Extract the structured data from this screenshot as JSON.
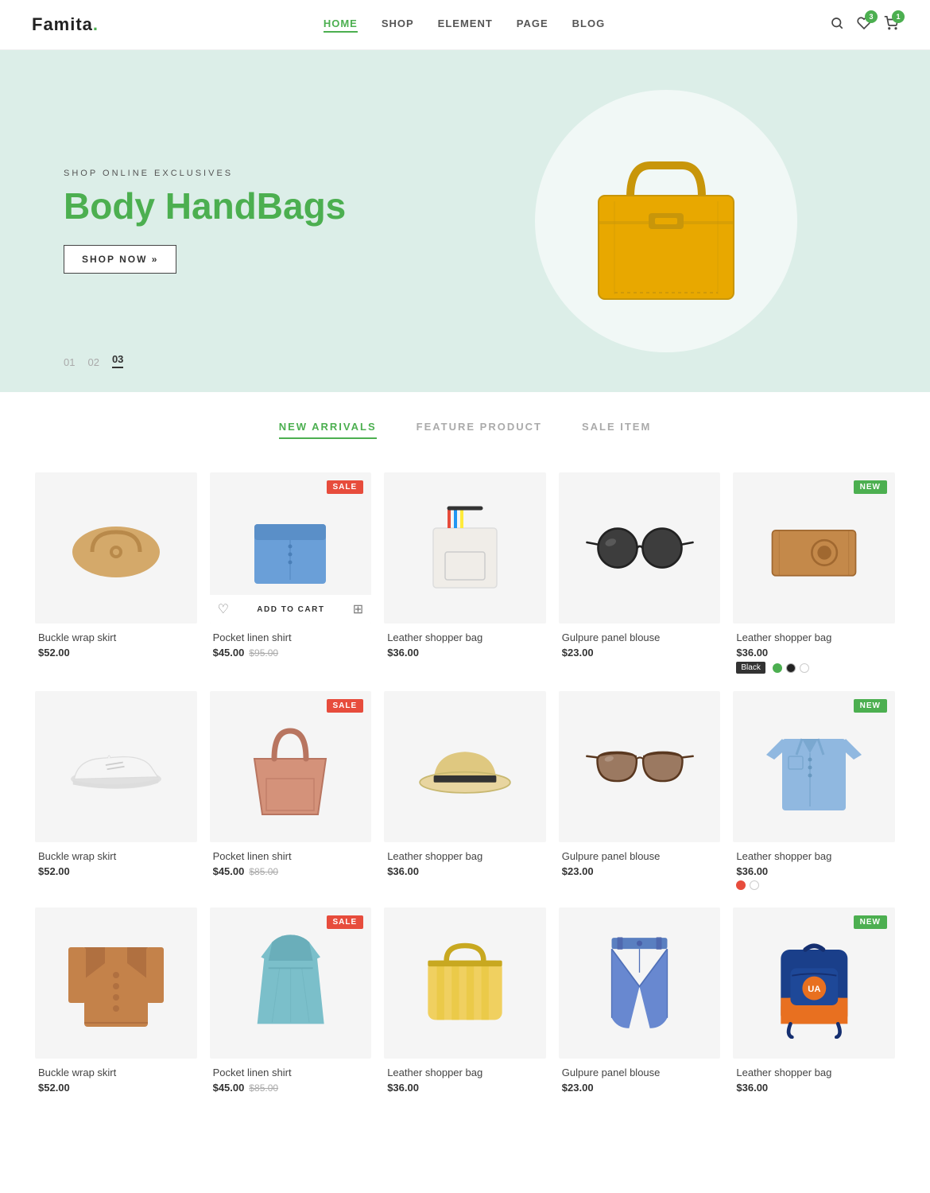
{
  "brand": {
    "name": "Famita",
    "dot": "."
  },
  "nav": {
    "links": [
      {
        "label": "HOME",
        "active": true
      },
      {
        "label": "SHOP",
        "active": false
      },
      {
        "label": "ELEMENT",
        "active": false
      },
      {
        "label": "PAGE",
        "active": false
      },
      {
        "label": "BLOG",
        "active": false
      }
    ],
    "cart_count": "1",
    "wishlist_count": "3"
  },
  "hero": {
    "subtitle": "SHOP ONLINE EXCLUSIVES",
    "title_black": "Body ",
    "title_green": "HandBags",
    "btn_label": "SHOP NOW »",
    "dots": [
      "01",
      "02",
      "03"
    ],
    "active_dot": 2
  },
  "tabs": [
    {
      "label": "NEW ARRIVALS",
      "active": true
    },
    {
      "label": "FEATURE PRODUCT",
      "active": false
    },
    {
      "label": "SALE ITEM",
      "active": false
    }
  ],
  "products": [
    {
      "name": "Buckle wrap skirt",
      "price": "$52.00",
      "old_price": "",
      "badge": "",
      "type": "bag",
      "color": "tan"
    },
    {
      "name": "Pocket linen shirt",
      "price": "$45.00",
      "old_price": "$95.00",
      "badge": "SALE",
      "type": "shirt_blue",
      "color": "blue",
      "show_actions": true
    },
    {
      "name": "Leather shopper bag",
      "price": "$36.00",
      "old_price": "",
      "badge": "",
      "type": "bag_white",
      "color": "white"
    },
    {
      "name": "Gulpure panel blouse",
      "price": "$23.00",
      "old_price": "",
      "badge": "",
      "type": "sunglasses_dark",
      "color": "black"
    },
    {
      "name": "Leather shopper bag",
      "price": "$36.00",
      "old_price": "",
      "badge": "NEW",
      "type": "bag_brown",
      "color": "brown",
      "color_dots": [
        "green",
        "black",
        "white"
      ],
      "color_label": "Black"
    },
    {
      "name": "Buckle wrap skirt",
      "price": "$52.00",
      "old_price": "",
      "badge": "",
      "type": "sneakers",
      "color": "white"
    },
    {
      "name": "Pocket linen shirt",
      "price": "$45.00",
      "old_price": "$85.00",
      "badge": "SALE",
      "type": "bag_pink",
      "color": "pink"
    },
    {
      "name": "Leather shopper bag",
      "price": "$36.00",
      "old_price": "",
      "badge": "",
      "type": "hat",
      "color": "beige"
    },
    {
      "name": "Gulpure panel blouse",
      "price": "$23.00",
      "old_price": "",
      "badge": "",
      "type": "sunglasses_brown",
      "color": "brown"
    },
    {
      "name": "Leather shopper bag",
      "price": "$36.00",
      "old_price": "",
      "badge": "NEW",
      "type": "shirt_light",
      "color": "light_blue",
      "color_dots": [
        "red",
        "white"
      ],
      "color_label": ""
    },
    {
      "name": "Buckle wrap skirt",
      "price": "$52.00",
      "old_price": "",
      "badge": "",
      "type": "jacket_brown",
      "color": "brown"
    },
    {
      "name": "Pocket linen shirt",
      "price": "$45.00",
      "old_price": "$85.00",
      "badge": "SALE",
      "type": "dress_blue",
      "color": "blue"
    },
    {
      "name": "Leather shopper bag",
      "price": "$36.00",
      "old_price": "",
      "badge": "",
      "type": "bag_striped",
      "color": "yellow"
    },
    {
      "name": "Gulpure panel blouse",
      "price": "$23.00",
      "old_price": "",
      "badge": "",
      "type": "jeans",
      "color": "blue"
    },
    {
      "name": "Leather shopper bag",
      "price": "$36.00",
      "old_price": "",
      "badge": "NEW",
      "type": "backpack",
      "color": "orange"
    }
  ],
  "add_to_cart_label": "ADD TO CART"
}
